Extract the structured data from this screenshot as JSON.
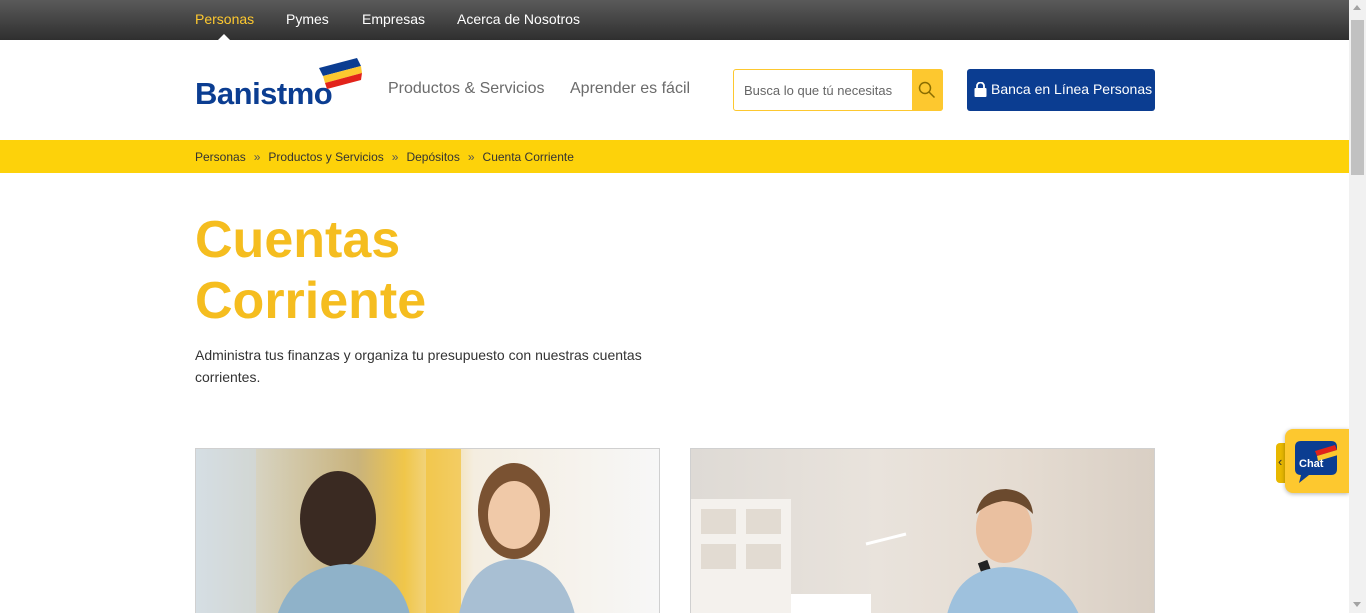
{
  "topnav": {
    "items": [
      {
        "label": "Personas",
        "active": true
      },
      {
        "label": "Pymes",
        "active": false
      },
      {
        "label": "Empresas",
        "active": false
      },
      {
        "label": "Acerca de Nosotros",
        "active": false
      }
    ]
  },
  "header": {
    "logo_text": "Banistmo",
    "nav": [
      "Productos & Servicios",
      "Aprender es fácil"
    ],
    "search_placeholder": "Busca lo que tú necesitas",
    "login_label": "Banca en Línea Personas"
  },
  "breadcrumb": [
    "Personas",
    "Productos y Servicios",
    "Depósitos",
    "Cuenta Corriente"
  ],
  "breadcrumb_separator": "»",
  "main": {
    "title_line1": "Cuentas",
    "title_line2": "Corriente",
    "description": "Administra tus finanzas y organiza tu presupuesto con nuestras cuentas corrientes."
  },
  "chat": {
    "label": "Chat",
    "tab_glyph": "‹"
  },
  "colors": {
    "brand_blue": "#0b3d91",
    "brand_yellow": "#fdc82f",
    "title_yellow": "#f5bd1f",
    "breadcrumb_bg": "#fdd20a"
  }
}
